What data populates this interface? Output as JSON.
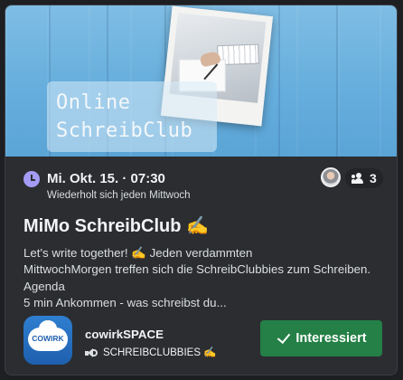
{
  "banner": {
    "label_line1": "Online",
    "label_line2": "SchreibClub"
  },
  "event": {
    "icon": "clock-icon",
    "date_time": "Mi. Okt. 15. · 07:30",
    "recurrence": "Wiederholt sich jeden Mittwoch",
    "interested_count": "3",
    "title": "MiMo SchreibClub ✍️",
    "description_lines": [
      "Let's write together!  ✍️ Jeden verdammten",
      "MittwochMorgen treffen sich die SchreibClubbies zum Schreiben.",
      "Agenda",
      "5 min Ankommen - was schreibst du..."
    ]
  },
  "server": {
    "icon_text": "COWIRK",
    "name": "cowirkSPACE",
    "channel_icon": "speaker-icon",
    "channel": "SCHREIBCLUBBIES ✍️"
  },
  "actions": {
    "interested_label": "Interessiert"
  },
  "colors": {
    "accent_button": "#248046",
    "clock": "#a39bf4",
    "card": "#2b2d31"
  }
}
